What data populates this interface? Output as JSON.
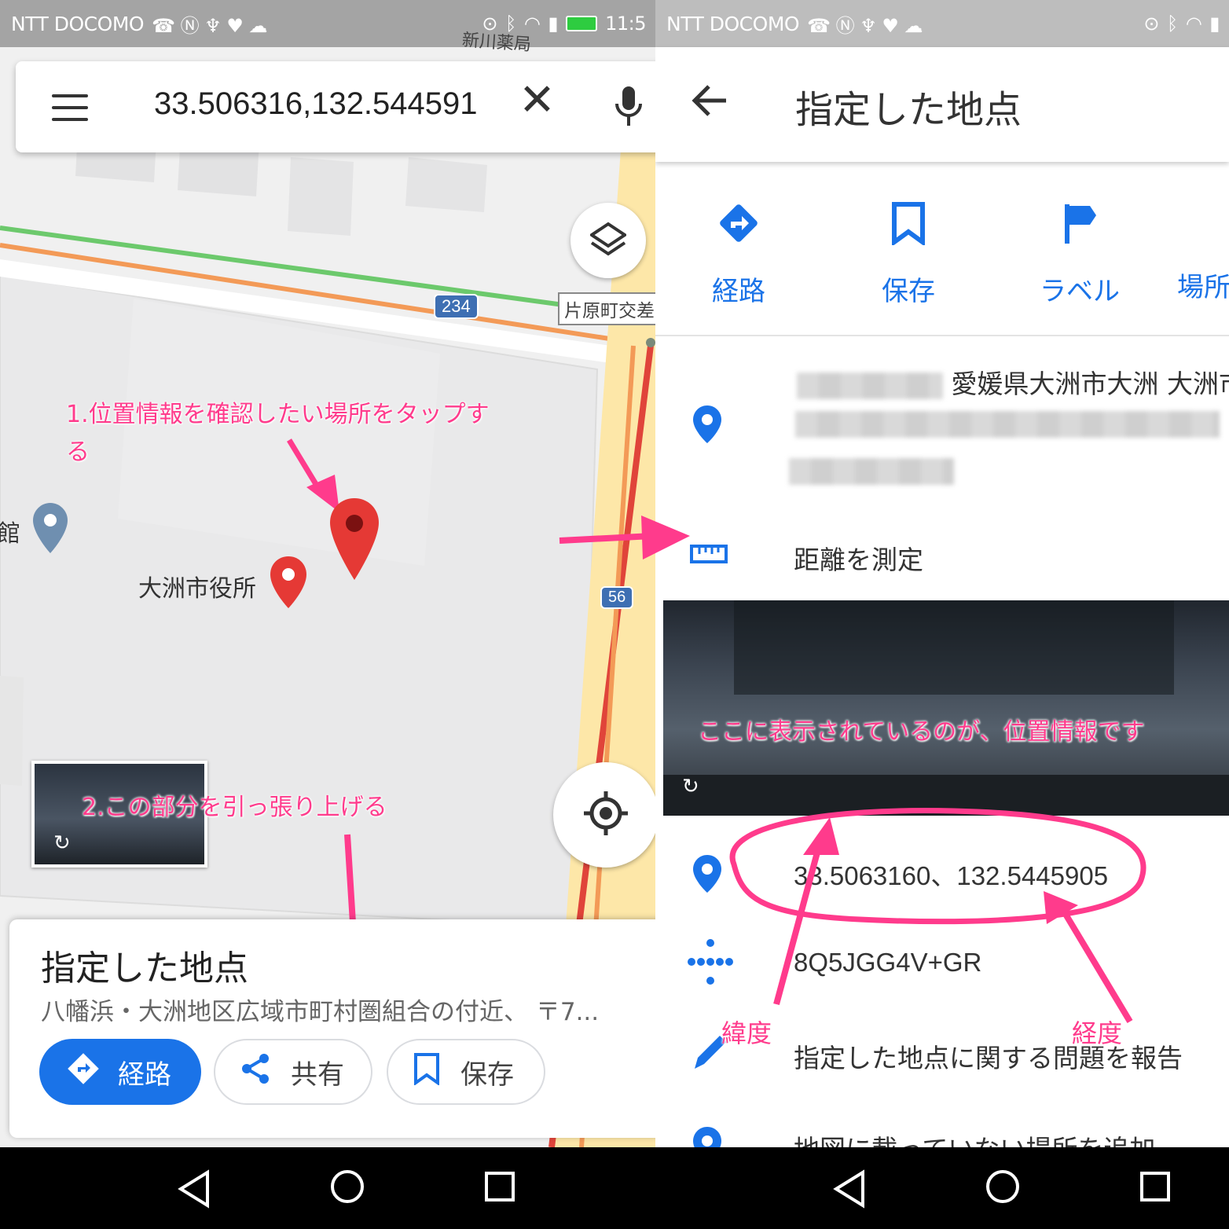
{
  "left": {
    "status": {
      "carrier": "NTT DOCOMO",
      "time": "11:5"
    },
    "search": {
      "query": "33.506316,132.544591"
    },
    "map": {
      "pharmacy_label": "新川薬局",
      "route_234": "234",
      "route_56": "56",
      "intersection": "片原町交差",
      "poi_left": "館",
      "city_hall": "大洲市役所"
    },
    "annotations": {
      "step1_line1": "1.位置情報を確認したい場所をタップす",
      "step1_line2": "る",
      "step2": "2.この部分を引っ張り上げる"
    },
    "card": {
      "title": "指定した地点",
      "subtitle": "八幡浜・大洲地区広域市町村圏組合の付近、 〒7...",
      "directions_label": "経路",
      "share_label": "共有",
      "save_label": "保存"
    }
  },
  "right": {
    "status": {
      "carrier": "NTT DOCOMO"
    },
    "header_title": "指定した地点",
    "actions": [
      {
        "label": "経路",
        "icon": "directions-icon"
      },
      {
        "label": "保存",
        "icon": "bookmark-icon"
      },
      {
        "label": "ラベル",
        "icon": "flag-icon"
      },
      {
        "label": "場所",
        "icon": "more-icon"
      }
    ],
    "address_visible": "愛媛県大洲市大洲 大洲市",
    "measure_label": "距離を測定",
    "photo_annotation": "ここに表示されているのが、位置情報です",
    "coordinates": "33.5063160、132.5445905",
    "plus_code": "8Q5JGG4V+GR",
    "report_label": "指定した地点に関する問題を報告",
    "add_place_label": "地図に載っていない場所を追加",
    "latitude_annotation": "緯度",
    "longitude_annotation": "経度"
  },
  "colors": {
    "accent_blue": "#1a73e8",
    "annotation_pink": "#ff3b8c",
    "pin_red": "#e53935"
  }
}
